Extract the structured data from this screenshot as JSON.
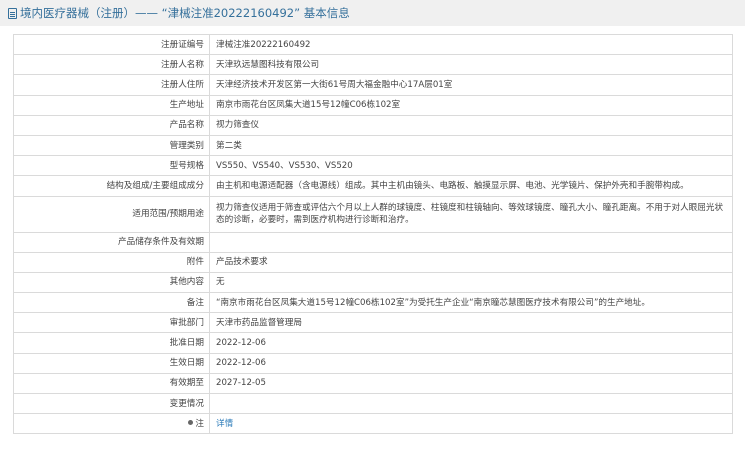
{
  "header": {
    "icon": "document-icon",
    "title": "境内医疗器械（注册）—— “津械注准20222160492” 基本信息"
  },
  "rows": [
    {
      "label": "注册证编号",
      "value": "津械注准20222160492"
    },
    {
      "label": "注册人名称",
      "value": "天津玖远慧图科技有限公司"
    },
    {
      "label": "注册人住所",
      "value": "天津经济技术开发区第一大街61号周大福金融中心17A层01室"
    },
    {
      "label": "生产地址",
      "value": "南京市雨花台区凤集大道15号12幢C06栋102室"
    },
    {
      "label": "产品名称",
      "value": "视力筛查仪"
    },
    {
      "label": "管理类别",
      "value": "第二类"
    },
    {
      "label": "型号规格",
      "value": "VS550、VS540、VS530、VS520"
    },
    {
      "label": "结构及组成/主要组成成分",
      "value": "由主机和电源适配器（含电源线）组成。其中主机由镜头、电路板、触摸显示屏、电池、光学镜片、保护外壳和手腕带构成。"
    },
    {
      "label": "适用范围/预期用途",
      "value": "视力筛查仪适用于筛查或评估六个月以上人群的球镜度、柱镜度和柱镜轴向、等效球镜度、瞳孔大小、瞳孔距离。不用于对人眼屈光状态的诊断，必要时，需到医疗机构进行诊断和治疗。"
    },
    {
      "label": "产品储存条件及有效期",
      "value": ""
    },
    {
      "label": "附件",
      "value": "产品技术要求"
    },
    {
      "label": "其他内容",
      "value": "无"
    },
    {
      "label": "备注",
      "value": "“南京市雨花台区凤集大道15号12幢C06栋102室”为受托生产企业“南京瞳芯慧图医疗技术有限公司”的生产地址。"
    },
    {
      "label": "审批部门",
      "value": "天津市药品监督管理局"
    },
    {
      "label": "批准日期",
      "value": "2022-12-06"
    },
    {
      "label": "生效日期",
      "value": "2022-12-06"
    },
    {
      "label": "有效期至",
      "value": "2027-12-05"
    },
    {
      "label": "变更情况",
      "value": ""
    },
    {
      "label": "注",
      "value": "详情"
    }
  ]
}
